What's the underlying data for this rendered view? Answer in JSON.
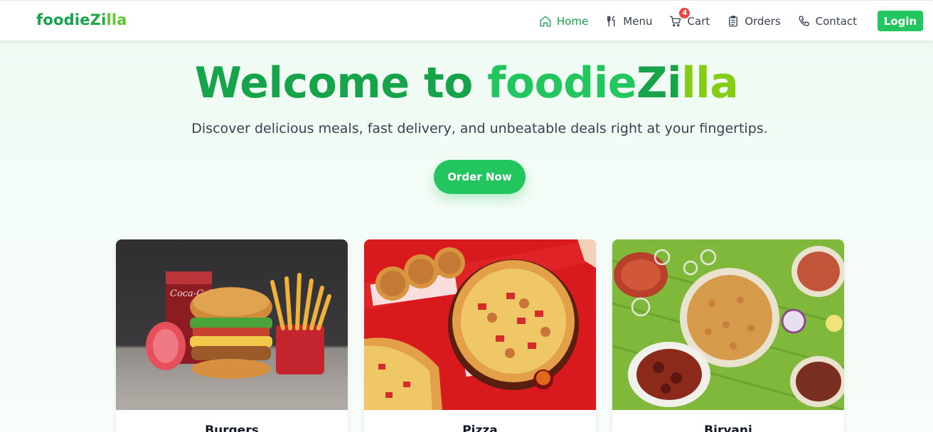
{
  "navbar": {
    "brand": {
      "part1": "foodie",
      "part2": "Zi",
      "part3": "lla"
    },
    "items": [
      {
        "label": "Home",
        "icon": "home-icon",
        "active": true
      },
      {
        "label": "Menu",
        "icon": "utensils-icon"
      },
      {
        "label": "Cart",
        "icon": "cart-icon",
        "badge": "4"
      },
      {
        "label": "Orders",
        "icon": "clipboard-icon"
      },
      {
        "label": "Contact",
        "icon": "phone-icon"
      }
    ],
    "login_label": "Login"
  },
  "hero": {
    "title_prefix": "Welcome to ",
    "title_brand_1": "foodie",
    "title_brand_2": "Zi",
    "title_brand_3": "lla",
    "subtitle": "Discover delicious meals, fast delivery, and unbeatable deals right at your fingertips.",
    "cta_label": "Order Now"
  },
  "categories": [
    {
      "name": "Burgers",
      "image": "burger-combo-image"
    },
    {
      "name": "Pizza",
      "image": "pizza-image"
    },
    {
      "name": "Biryani",
      "image": "biryani-spread-image"
    }
  ],
  "colors": {
    "primary": "#22c55e",
    "primary_dark": "#16a34a",
    "accent_lime": "#84cc16",
    "badge": "#ef4444",
    "text": "#374151"
  }
}
